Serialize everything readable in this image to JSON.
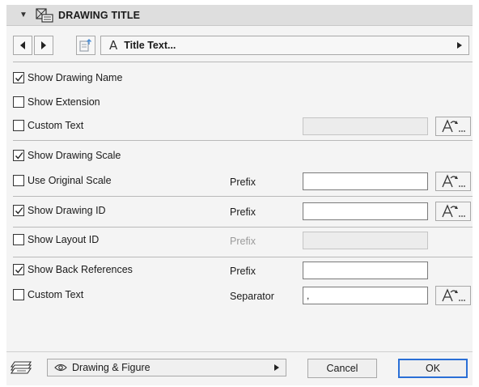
{
  "header": {
    "title": "DRAWING TITLE",
    "collapse_icon": "triangle-down-icon",
    "title_icon": "drawing-title-icon"
  },
  "nav": {
    "prev_icon": "arrow-left-icon",
    "next_icon": "arrow-right-icon",
    "pick_icon": "pick-up-parameters-icon",
    "style_label": "Title Text..."
  },
  "rows": {
    "show_drawing_name": {
      "label": "Show Drawing Name",
      "checked": true
    },
    "show_extension": {
      "label": "Show Extension",
      "checked": false
    },
    "custom_text_1": {
      "label": "Custom Text",
      "checked": false,
      "value": ""
    },
    "show_drawing_scale": {
      "label": "Show Drawing Scale",
      "checked": true
    },
    "use_original_scale": {
      "label": "Use Original Scale",
      "checked": false,
      "field_label": "Prefix",
      "value": ""
    },
    "show_drawing_id": {
      "label": "Show Drawing ID",
      "checked": true,
      "field_label": "Prefix",
      "value": ""
    },
    "show_layout_id": {
      "label": "Show Layout ID",
      "checked": false,
      "field_label": "Prefix",
      "value": ""
    },
    "show_back_references": {
      "label": "Show Back References",
      "checked": true,
      "field_label": "Prefix",
      "value": ""
    },
    "custom_text_2": {
      "label": "Custom Text",
      "checked": false,
      "field_label": "Separator",
      "value": ","
    }
  },
  "footer": {
    "layer_icon": "layer-icon",
    "layer_label": "Drawing & Figure",
    "eye_icon": "eye-icon",
    "cancel_label": "Cancel",
    "ok_label": "OK"
  },
  "colors": {
    "header_bg": "#dedede",
    "panel_bg": "#f4f4f4",
    "ok_border": "#2a6fd6"
  }
}
